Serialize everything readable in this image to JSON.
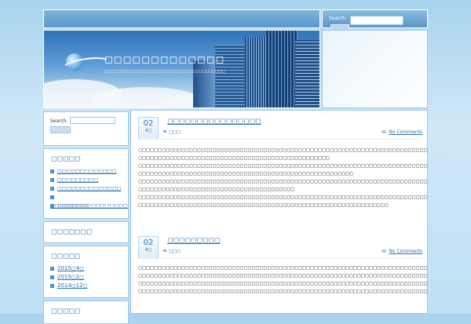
{
  "header": {
    "site_title": "◻◻◻◻◻◻◻◻◻◻◻◻◻",
    "site_description": "◻◻◻◻◻◻◻◻◻◻◻◻◻◻◻◻◻◻◻◻◻◻◻◻◻◻◻◻◻◻◻◻◻◻◻◻◻"
  },
  "header_search": {
    "label": "Search:",
    "placeholder": ""
  },
  "sidebar": {
    "search": {
      "label": "Search:",
      "button": ""
    },
    "recent": {
      "heading": "◻◻◻◻◻",
      "items": [
        "◻◻◻◻◻◻◻◻◻◻◻◻◻",
        "◻◻◻◻◻◻◻◻◻",
        "◻◻◻◻◻◻◻◻◻◻◻◻◻◻",
        "◻◻◻◻◻◻◻◻◻◻◻◻◻◻◻◻◻",
        "◻◻◻◻◻◻◻"
      ]
    },
    "comments_heading": "◻◻◻◻◻◻◻",
    "archives": {
      "heading": "◻◻◻◻◻",
      "items": [
        "2015◻4◻",
        "2015◻2◻",
        "2014◻12◻"
      ]
    },
    "categories_heading": "◻◻◻◻◻"
  },
  "posts": [
    {
      "day": "02",
      "month": "4◻",
      "title": "◻◻◻◻◻◻◻◻◻◻◻◻◻◻◻◻",
      "category": "◻◻◻",
      "comments": "No Comments",
      "body": "◻◻◻◻◻◻◻◻◻◻◻◻◻◻◻◻◻◻◻◻◻◻◻◻◻◻◻◻◻◻◻◻◻◻◻◻◻◻◻◻◻◻◻◻◻◻◻◻◻◻◻◻◻◻◻◻◻◻◻◻◻◻◻◻◻◻◻◻◻◻◻◻◻◻◻◻◻◻◻◻◻◻◻◻\n◻◻◻◻◻◻◻◻◻◻◻◻◻◻◻◻◻◻◻◻◻◻◻◻◻◻◻◻◻◻◻◻◻◻◻◻◻◻◻◻◻◻◻◻◻◻◻◻◻\n◻◻◻◻◻◻◻◻◻◻◻◻◻◻◻◻◻◻◻◻◻◻◻◻◻◻◻◻◻◻◻◻◻◻◻◻◻◻◻◻◻◻◻◻◻◻◻◻◻◻◻◻◻◻◻◻◻◻◻◻◻◻◻◻◻◻◻◻◻◻◻◻◻◻◻◻◻◻◻◻◻◻◻\n◻◻◻◻◻◻◻◻◻◻◻◻◻◻◻◻◻◻◻◻◻◻◻◻◻◻◻◻◻◻◻◻◻◻◻◻◻◻◻◻◻◻◻◻◻◻◻◻◻◻◻◻◻◻◻\n◻◻◻◻◻◻◻◻◻◻◻◻◻◻◻◻◻◻◻◻◻◻◻◻◻◻◻◻◻◻◻◻◻◻◻◻◻◻◻◻◻◻◻◻◻◻◻◻◻◻◻◻◻◻◻◻◻◻◻◻◻◻◻◻◻◻◻◻◻◻◻◻◻◻◻◻◻◻◻◻◻◻◻◻\n◻◻◻◻◻◻◻◻◻◻◻◻◻◻◻◻◻◻◻◻◻◻◻◻◻◻◻◻◻◻◻◻◻◻◻◻◻◻◻◻\n◻◻◻◻◻◻◻◻◻◻◻◻◻◻◻◻◻◻◻◻◻◻◻◻◻◻◻◻◻◻◻◻◻◻◻◻◻◻◻◻◻◻◻◻◻◻◻◻◻◻◻◻◻◻◻◻◻◻◻◻◻◻◻◻◻◻◻◻◻◻◻◻◻◻◻◻◻◻◻◻◻◻◻◻\n◻◻◻◻◻◻◻◻◻◻◻◻◻◻◻◻◻◻◻◻◻◻◻◻◻◻◻◻◻◻◻◻◻◻◻◻◻◻◻◻◻◻◻◻◻◻◻◻◻◻◻◻◻◻◻◻◻◻◻◻◻◻◻◻"
    },
    {
      "day": "02",
      "month": "4◻",
      "title": "◻◻◻◻◻◻◻◻◻",
      "category": "◻◻◻",
      "comments": "No Comments",
      "body": "◻◻◻◻◻◻◻◻◻◻◻◻◻◻◻◻◻◻◻◻◻◻◻◻◻◻◻◻◻◻◻◻◻◻◻◻◻◻◻◻◻◻◻◻◻◻◻◻◻◻◻◻◻◻◻◻◻◻◻◻◻◻◻◻◻◻◻◻◻◻◻◻◻◻◻◻◻◻◻◻◻◻◻◻\n◻◻◻◻◻◻◻◻◻◻◻◻◻◻◻◻◻◻◻◻◻◻◻◻◻◻◻◻◻◻◻◻◻◻◻◻◻◻◻◻◻◻◻◻◻◻◻◻◻◻◻◻◻◻◻◻◻◻◻◻◻◻◻◻◻◻◻◻◻◻◻◻◻◻◻◻◻◻\n◻◻◻◻◻◻◻◻◻◻◻◻◻◻◻◻◻◻◻◻◻◻◻◻◻◻◻◻◻◻◻◻◻◻◻◻◻◻◻◻◻◻◻◻◻◻◻◻◻◻◻◻◻◻◻◻◻◻◻◻◻◻◻◻◻◻◻◻◻◻◻◻◻◻◻◻◻◻\n◻◻◻◻◻◻◻◻◻◻◻◻◻◻◻◻◻◻◻◻◻◻◻◻◻◻◻◻◻◻◻◻◻◻◻◻◻◻◻◻◻◻◻◻◻◻◻◻◻◻◻◻◻◻◻◻◻◻◻◻◻◻◻◻◻◻◻◻◻◻◻◻◻◻◻◻◻◻◻◻◻◻◻◻"
    }
  ]
}
